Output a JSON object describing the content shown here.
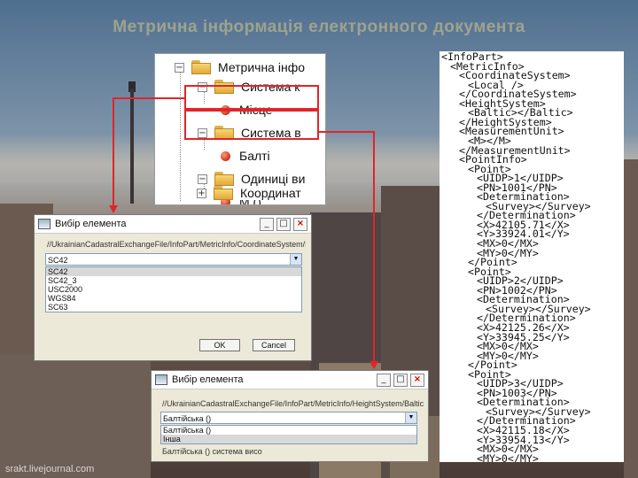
{
  "slide": {
    "title": "Метрична інформація електронного документа",
    "watermark": "srakt.livejournal.com"
  },
  "tree": {
    "items": [
      {
        "expander": "−",
        "icon": "folder",
        "label": "Метрична інфо"
      },
      {
        "expander": "−",
        "icon": "folder",
        "label": "Система к"
      },
      {
        "expander": "",
        "icon": "dot",
        "label": "Місце"
      },
      {
        "expander": "−",
        "icon": "folder",
        "label": "Система в"
      },
      {
        "expander": "",
        "icon": "dot",
        "label": "Балті"
      },
      {
        "expander": "−",
        "icon": "folder",
        "label": "Одиниці ви"
      },
      {
        "expander": "",
        "icon": "dot",
        "label": "М ()"
      },
      {
        "expander": "+",
        "icon": "folder",
        "label": "Координат"
      }
    ]
  },
  "dialog1": {
    "title": "Вибір елемента",
    "path": "//UkrainianCadastralExchangeFile/InfoPart/MetricInfo/CoordinateSystem/Loca",
    "selected_value": "SC42",
    "options": [
      "SC42",
      "SC42_3",
      "USC2000",
      "WGS84",
      "SC63"
    ],
    "ok_label": "OK",
    "cancel_label": "Cancel"
  },
  "dialog2": {
    "title": "Вибір елемента",
    "path": "//UkrainianCadastralExchangeFile/InfoPart/MetricInfo/HeightSystem/Baltic",
    "selected_value": "Балтійська ()",
    "options": [
      "Балтійська ()",
      "Інша"
    ],
    "extra_text": "Балтійська () система висо"
  },
  "xml": {
    "lines": [
      {
        "indent": 0,
        "text": "<InfoPart>"
      },
      {
        "indent": 1,
        "text": "<MetricInfo>"
      },
      {
        "indent": 2,
        "text": "<CoordinateSystem>"
      },
      {
        "indent": 3,
        "text": "<Local />"
      },
      {
        "indent": 2,
        "text": "</CoordinateSystem>"
      },
      {
        "indent": 2,
        "text": "<HeightSystem>"
      },
      {
        "indent": 3,
        "text": "<Baltic></Baltic>"
      },
      {
        "indent": 2,
        "text": "</HeightSystem>"
      },
      {
        "indent": 2,
        "text": "<MeasurementUnit>"
      },
      {
        "indent": 3,
        "text": "<M></M>"
      },
      {
        "indent": 2,
        "text": "</MeasurementUnit>"
      },
      {
        "indent": 2,
        "text": "<PointInfo>"
      },
      {
        "indent": 3,
        "text": "<Point>"
      },
      {
        "indent": 4,
        "text": "<UIDP>1</UIDP>"
      },
      {
        "indent": 4,
        "text": "<PN>1001</PN>"
      },
      {
        "indent": 4,
        "text": "<Determination>"
      },
      {
        "indent": 5,
        "text": "<Survey></Survey>"
      },
      {
        "indent": 4,
        "text": "</Determination>"
      },
      {
        "indent": 4,
        "text": "<X>42105.71</X>"
      },
      {
        "indent": 4,
        "text": "<Y>33924.01</Y>"
      },
      {
        "indent": 4,
        "text": "<MX>0</MX>"
      },
      {
        "indent": 4,
        "text": "<MY>0</MY>"
      },
      {
        "indent": 3,
        "text": "</Point>"
      },
      {
        "indent": 3,
        "text": "<Point>"
      },
      {
        "indent": 4,
        "text": "<UIDP>2</UIDP>"
      },
      {
        "indent": 4,
        "text": "<PN>1002</PN>"
      },
      {
        "indent": 4,
        "text": "<Determination>"
      },
      {
        "indent": 5,
        "text": "<Survey></Survey>"
      },
      {
        "indent": 4,
        "text": "</Determination>"
      },
      {
        "indent": 4,
        "text": "<X>42125.26</X>"
      },
      {
        "indent": 4,
        "text": "<Y>33945.25</Y>"
      },
      {
        "indent": 4,
        "text": "<MX>0</MX>"
      },
      {
        "indent": 4,
        "text": "<MY>0</MY>"
      },
      {
        "indent": 3,
        "text": "</Point>"
      },
      {
        "indent": 3,
        "text": "<Point>"
      },
      {
        "indent": 4,
        "text": "<UIDP>3</UIDP>"
      },
      {
        "indent": 4,
        "text": "<PN>1003</PN>"
      },
      {
        "indent": 4,
        "text": "<Determination>"
      },
      {
        "indent": 5,
        "text": "<Survey></Survey>"
      },
      {
        "indent": 4,
        "text": "</Determination>"
      },
      {
        "indent": 4,
        "text": "<X>42115.18</X>"
      },
      {
        "indent": 4,
        "text": "<Y>33954.13</Y>"
      },
      {
        "indent": 4,
        "text": "<MX>0</MX>"
      },
      {
        "indent": 4,
        "text": "<MY>0</MY>"
      }
    ]
  },
  "colors": {
    "highlight_red": "#e0252a",
    "title_gold": "#d8c88a"
  }
}
